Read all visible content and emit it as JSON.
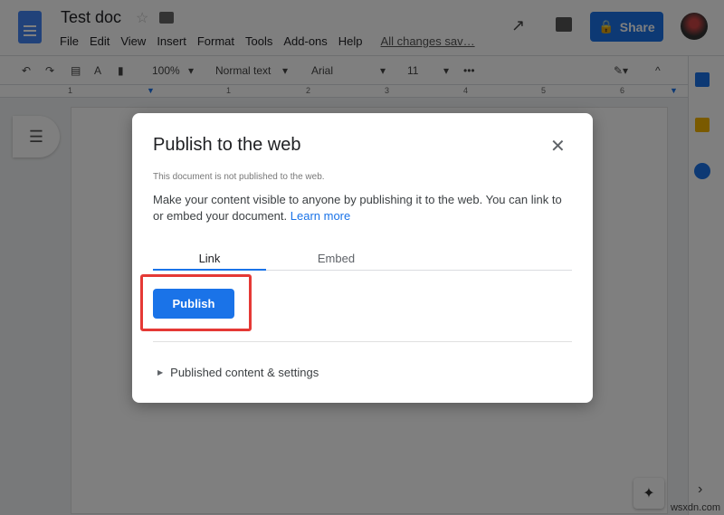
{
  "header": {
    "title": "Test doc",
    "menu": [
      "File",
      "Edit",
      "View",
      "Insert",
      "Format",
      "Tools",
      "Add-ons",
      "Help"
    ],
    "saved_status": "All changes sav…",
    "share_label": "Share"
  },
  "toolbar": {
    "zoom": "100%",
    "style": "Normal text",
    "font": "Arial",
    "size": "11",
    "more": "•••"
  },
  "ruler": {
    "ticks": [
      "1",
      "1",
      "2",
      "3",
      "4",
      "5",
      "6"
    ]
  },
  "dialog": {
    "title": "Publish to the web",
    "close": "✕",
    "status": "This document is not published to the web.",
    "description": "Make your content visible to anyone by publishing it to the web. You can link to or embed your document.",
    "learn_more": "Learn more",
    "tabs": [
      {
        "label": "Link",
        "active": true
      },
      {
        "label": "Embed",
        "active": false
      }
    ],
    "publish_label": "Publish",
    "settings_label": "Published content & settings"
  },
  "colors": {
    "accent": "#1a73e8",
    "highlight": "#e53935"
  },
  "watermark": "wsxdn.com"
}
